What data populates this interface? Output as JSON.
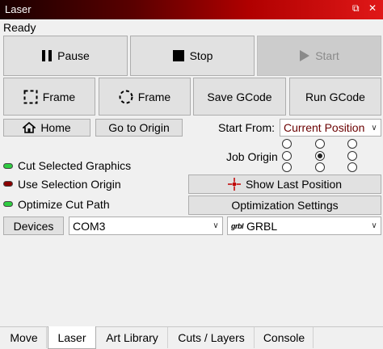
{
  "window": {
    "title": "Laser",
    "status": "Ready"
  },
  "controls": {
    "pause": "Pause",
    "stop": "Stop",
    "start": "Start",
    "frame_rect": "Frame",
    "frame_circle": "Frame",
    "save_gcode": "Save GCode",
    "run_gcode": "Run GCode",
    "home": "Home",
    "go_to_origin": "Go to Origin"
  },
  "start_from": {
    "label": "Start From:",
    "value": "Current Position"
  },
  "job_origin": {
    "label": "Job Origin",
    "selected": "center"
  },
  "options": [
    {
      "label": "Cut Selected Graphics",
      "state": "on"
    },
    {
      "label": "Use Selection Origin",
      "state": "off"
    },
    {
      "label": "Optimize Cut Path",
      "state": "on"
    }
  ],
  "show_last_position": "Show Last Position",
  "optimization_settings": "Optimization Settings",
  "devices": {
    "label": "Devices",
    "port": "COM3",
    "controller": "GRBL",
    "controller_logo": "grbl"
  },
  "tabs": [
    {
      "label": "Move",
      "active": false
    },
    {
      "label": "Laser",
      "active": true
    },
    {
      "label": "Art Library",
      "active": false
    },
    {
      "label": "Cuts / Layers",
      "active": false
    },
    {
      "label": "Console",
      "active": false
    }
  ],
  "colors": {
    "led_on": "#2ecc40",
    "led_off": "#8b0000",
    "start_from_text": "#6b0000"
  }
}
